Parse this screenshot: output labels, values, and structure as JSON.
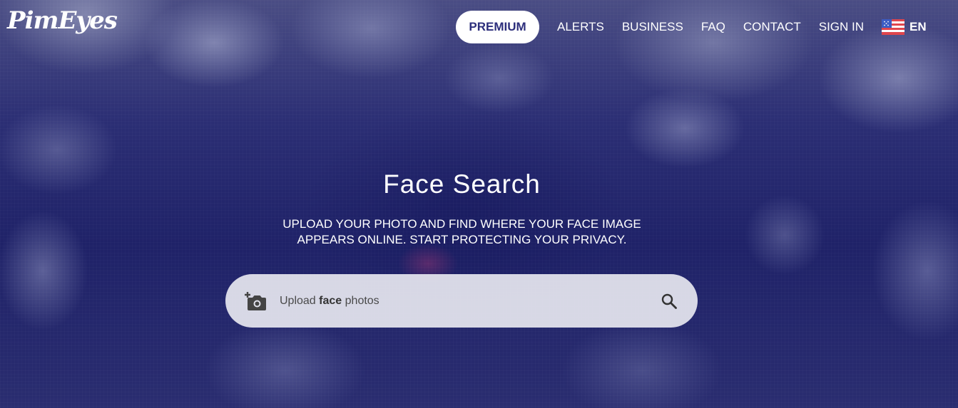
{
  "header": {
    "logo_text": "PimEyes",
    "premium_label": "PREMIUM",
    "nav_links": [
      "ALERTS",
      "BUSINESS",
      "FAQ",
      "CONTACT",
      "SIGN IN"
    ],
    "language_label": "EN",
    "language_flag_icon": "us-flag-icon"
  },
  "hero": {
    "title": "Face Search",
    "subtitle_line1": "UPLOAD YOUR PHOTO AND FIND WHERE YOUR FACE IMAGE",
    "subtitle_line2": "APPEARS ONLINE. START PROTECTING YOUR PRIVACY."
  },
  "search": {
    "upload_prefix": "Upload",
    "upload_bold": "face",
    "upload_suffix": "photos",
    "upload_icon": "add-camera-icon",
    "search_icon": "search-icon"
  },
  "colors": {
    "background": "#242768",
    "premium_text": "#2d2f7c",
    "search_bar": "#e1e2ec"
  }
}
